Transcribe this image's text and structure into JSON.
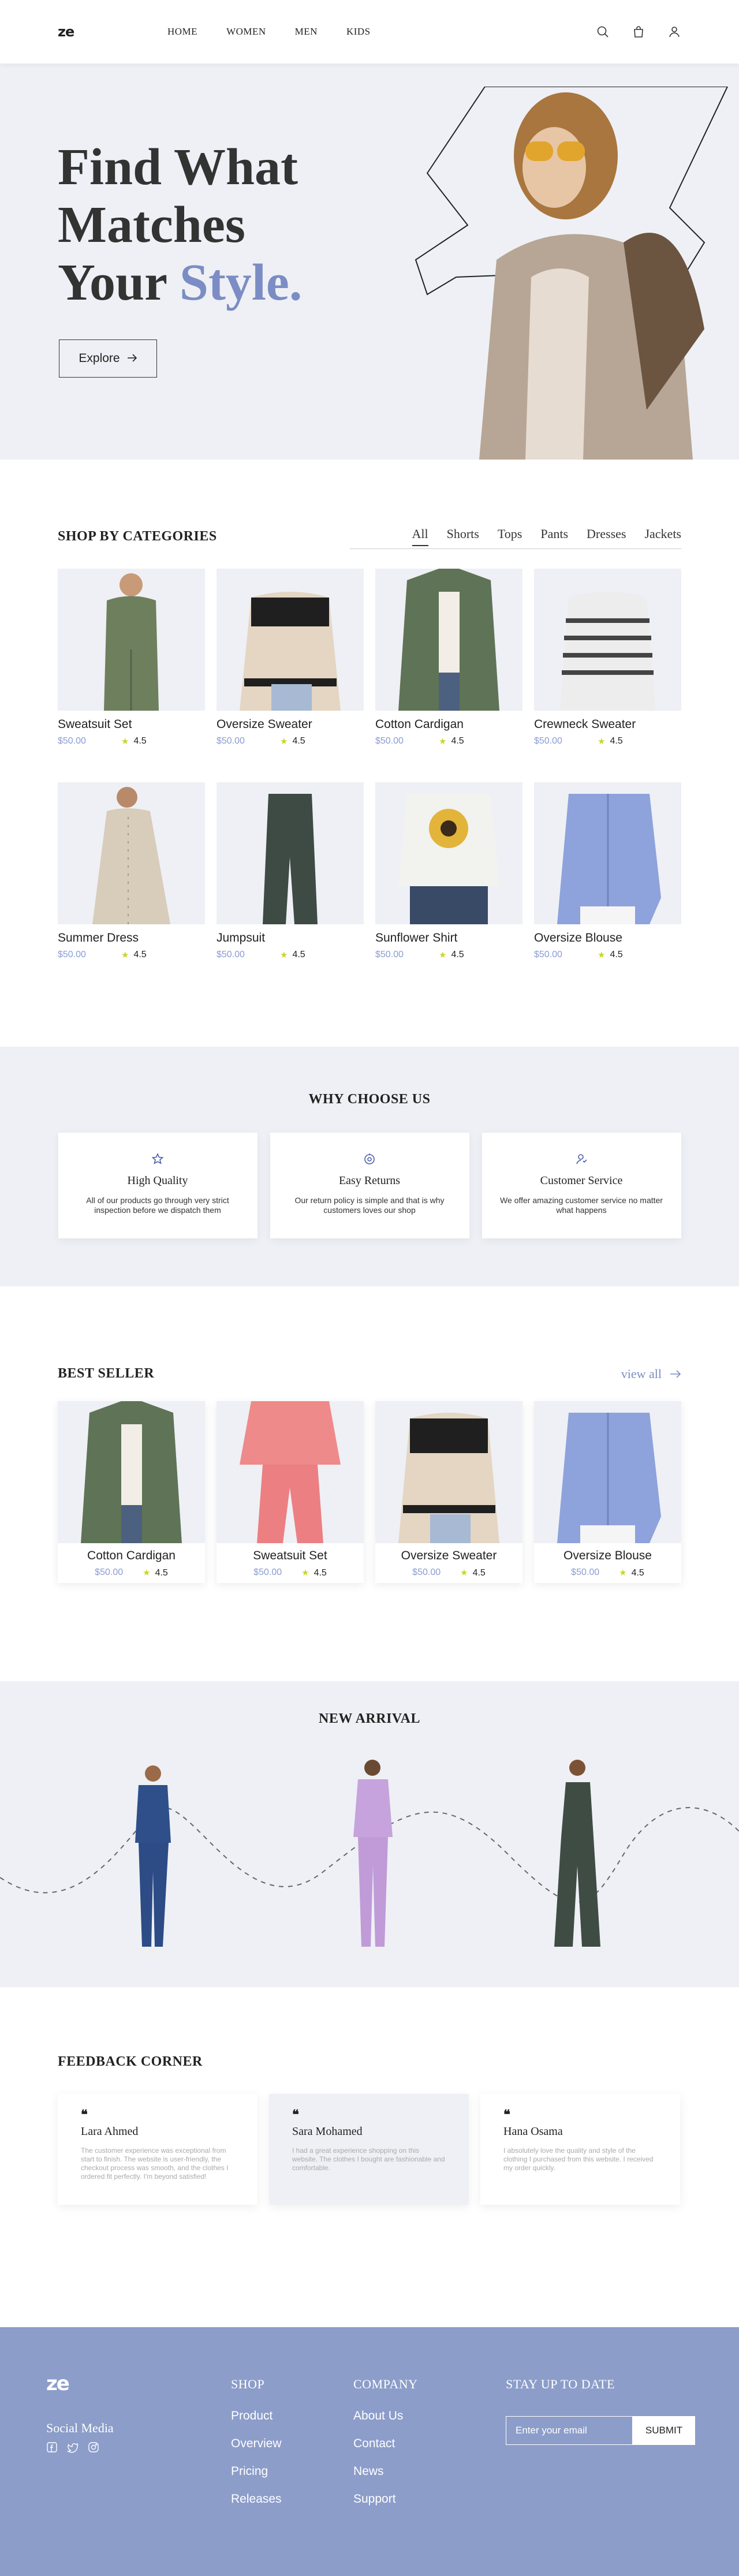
{
  "header": {
    "logo": "ze",
    "nav": [
      "HOME",
      "WOMEN",
      "MEN",
      "KIDS"
    ],
    "icons": [
      "search-icon",
      "bag-icon",
      "user-icon"
    ]
  },
  "hero": {
    "line1": "Find What",
    "line2": "Matches",
    "line3": "Your ",
    "accent": "Style.",
    "button": "Explore"
  },
  "categories": {
    "title": "SHOP BY CATEGORIES",
    "tabs": [
      "All",
      "Shorts",
      "Tops",
      "Pants",
      "Dresses",
      "Jackets"
    ],
    "active_tab": "All",
    "products": [
      {
        "name": "Sweatsuit Set",
        "price": "$50.00",
        "rating": "4.5"
      },
      {
        "name": "Oversize Sweater",
        "price": "$50.00",
        "rating": "4.5"
      },
      {
        "name": "Cotton Cardigan",
        "price": "$50.00",
        "rating": "4.5"
      },
      {
        "name": "Crewneck Sweater",
        "price": "$50.00",
        "rating": "4.5"
      },
      {
        "name": "Summer Dress",
        "price": "$50.00",
        "rating": "4.5"
      },
      {
        "name": "Jumpsuit",
        "price": "$50.00",
        "rating": "4.5"
      },
      {
        "name": "Sunflower Shirt",
        "price": "$50.00",
        "rating": "4.5"
      },
      {
        "name": "Oversize Blouse",
        "price": "$50.00",
        "rating": "4.5"
      }
    ]
  },
  "why": {
    "title": "WHY CHOOSE US",
    "features": [
      {
        "title": "High Quality",
        "text": "All of our products go through very strict inspection before we dispatch them",
        "icon": "badge-icon"
      },
      {
        "title": "Easy Returns",
        "text": "Our return policy is simple and that is why customers loves our shop",
        "icon": "return-icon"
      },
      {
        "title": "Customer Service",
        "text": "We offer amazing customer service no matter what happens",
        "icon": "support-icon"
      }
    ]
  },
  "best": {
    "title": "BEST SELLER",
    "view_all": "view all",
    "products": [
      {
        "name": "Cotton Cardigan",
        "price": "$50.00",
        "rating": "4.5"
      },
      {
        "name": "Sweatsuit Set",
        "price": "$50.00",
        "rating": "4.5"
      },
      {
        "name": "Oversize Sweater",
        "price": "$50.00",
        "rating": "4.5"
      },
      {
        "name": "Oversize Blouse",
        "price": "$50.00",
        "rating": "4.5"
      }
    ]
  },
  "arrival": {
    "title": "NEW ARRIVAL"
  },
  "feedback": {
    "title": "FEEDBACK CORNER",
    "reviews": [
      {
        "name": "Lara Ahmed",
        "text": "The customer experience was exceptional from start to finish. The website is user-friendly, the checkout process was smooth, and the clothes I ordered fit perfectly. I'm beyond satisfied!"
      },
      {
        "name": "Sara Mohamed",
        "text": "I had a great experience shopping on this website. The clothes I bought are fashionable and comfortable."
      },
      {
        "name": "Hana Osama",
        "text": "I absolutely love the quality and style of the clothing I purchased from this website. I received my order quickly."
      }
    ]
  },
  "footer": {
    "logo": "ze",
    "social_title": "Social Media",
    "social_icons": [
      "facebook-icon",
      "twitter-icon",
      "instagram-icon"
    ],
    "shop_title": "SHOP",
    "shop_links": [
      "Product",
      "Overview",
      "Pricing",
      "Releases"
    ],
    "company_title": "COMPANY",
    "company_links": [
      "About Us",
      "Contact",
      "News",
      "Support"
    ],
    "subscribe_title": "STAY UP TO DATE",
    "email_placeholder": "Enter your email",
    "submit": "SUBMIT"
  },
  "colors": {
    "accent": "#7b8dc4",
    "section_bg": "#eef0f5",
    "footer_bg": "#8c9dca",
    "star": "#c9d52b"
  }
}
